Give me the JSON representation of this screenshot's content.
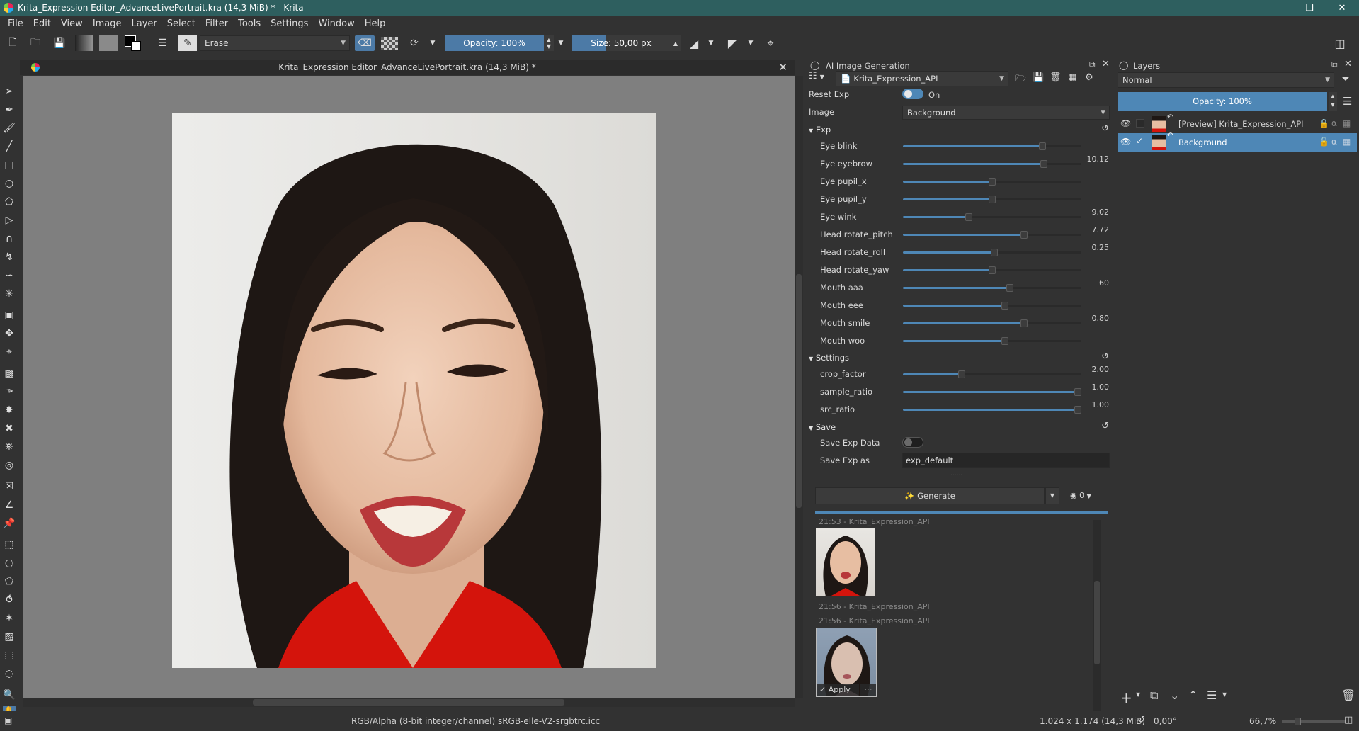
{
  "window": {
    "title": "Krita_Expression Editor_AdvanceLivePortrait.kra (14,3 MiB) * - Krita",
    "controls": [
      "minimize",
      "maximize",
      "close"
    ]
  },
  "menu": [
    "File",
    "Edit",
    "View",
    "Image",
    "Layer",
    "Select",
    "Filter",
    "Tools",
    "Settings",
    "Window",
    "Help"
  ],
  "toolbar": {
    "brush_preset": "Erase",
    "opacity": "Opacity: 100%",
    "size": "Size: 50,00 px"
  },
  "canvas": {
    "subwindow_title": "Krita_Expression Editor_AdvanceLivePortrait.kra (14,3 MiB) *"
  },
  "ai_panel": {
    "title": "AI Image Generation",
    "workspace": "Krita_Expression_API",
    "reset_exp_label": "Reset Exp",
    "reset_exp_state": "On",
    "image_label": "Image",
    "image_value": "Background",
    "exp_section": "Exp",
    "exp_params": [
      {
        "label": "Eye blink",
        "value": "",
        "pos": 0.78
      },
      {
        "label": "Eye eyebrow",
        "value": "10.12",
        "pos": 0.79
      },
      {
        "label": "Eye pupil_x",
        "value": "",
        "pos": 0.5
      },
      {
        "label": "Eye pupil_y",
        "value": "",
        "pos": 0.5
      },
      {
        "label": "Eye wink",
        "value": "9.02",
        "pos": 0.37
      },
      {
        "label": "Head rotate_pitch",
        "value": "7.72",
        "pos": 0.68
      },
      {
        "label": "Head rotate_roll",
        "value": "0.25",
        "pos": 0.51
      },
      {
        "label": "Head rotate_yaw",
        "value": "",
        "pos": 0.5
      },
      {
        "label": "Mouth aaa",
        "value": "60",
        "pos": 0.6
      },
      {
        "label": "Mouth eee",
        "value": "",
        "pos": 0.57
      },
      {
        "label": "Mouth smile",
        "value": "0.80",
        "pos": 0.68
      },
      {
        "label": "Mouth woo",
        "value": "",
        "pos": 0.57
      }
    ],
    "settings_section": "Settings",
    "settings_params": [
      {
        "label": "crop_factor",
        "value": "2.00",
        "pos": 0.33
      },
      {
        "label": "sample_ratio",
        "value": "1.00",
        "pos": 1.0
      },
      {
        "label": "src_ratio",
        "value": "1.00",
        "pos": 1.0
      }
    ],
    "save_section": "Save",
    "save_exp_data_label": "Save Exp Data",
    "save_exp_as_label": "Save Exp as",
    "save_exp_as_value": "exp_default",
    "generate_label": "Generate",
    "queue_count": "0",
    "history": [
      {
        "caption": "21:53 - Krita_Expression_API"
      },
      {
        "caption": "21:56 - Krita_Expression_API"
      },
      {
        "caption": "21:56 - Krita_Expression_API"
      }
    ],
    "apply_label": "Apply"
  },
  "layers_panel": {
    "title": "Layers",
    "blend_mode": "Normal",
    "opacity": "Opacity:  100%",
    "layers": [
      {
        "name": "[Preview] Krita_Expression_API",
        "selected": false
      },
      {
        "name": "Background",
        "selected": true
      }
    ]
  },
  "status": {
    "color_info": "RGB/Alpha (8-bit integer/channel)  sRGB-elle-V2-srgbtrc.icc",
    "dimensions": "1.024 x 1.174 (14,3 MiB)",
    "rotation": "0,00°",
    "zoom": "66,7%"
  },
  "colors": {
    "titlebar": "#2e5f5f",
    "accent": "#4e87b6",
    "panel_bg": "#323232",
    "canvas_bg": "#7f7f7f"
  }
}
